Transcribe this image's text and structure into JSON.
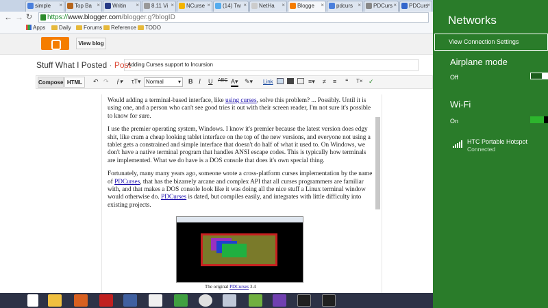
{
  "browser": {
    "tabs": [
      {
        "label": "simple",
        "color": "#4a7fdc"
      },
      {
        "label": "Top Ba",
        "color": "#b5651d"
      },
      {
        "label": "Writin",
        "color": "#263a86"
      },
      {
        "label": "8.11 Vi",
        "color": "#999999"
      },
      {
        "label": "NCurse",
        "color": "#f4b400"
      },
      {
        "label": "(14) Tw",
        "color": "#55acee"
      },
      {
        "label": "NetHa",
        "color": "#cccccc"
      },
      {
        "label": "Blogge",
        "color": "#f57d00"
      },
      {
        "label": "pdcurs",
        "color": "#4a7fdc"
      },
      {
        "label": "PDCurs",
        "color": "#888888"
      },
      {
        "label": "PDCurs",
        "color": "#3366cc"
      }
    ],
    "url_scheme": "https://",
    "url_host": "www.blogger.com",
    "url_rest": "/blogger.g?blogID",
    "bookmarks": [
      "Apps",
      "Daily",
      "Forums",
      "Reference",
      "TODO"
    ]
  },
  "blogger": {
    "view_blog": "View blog",
    "blog_name": "Stuff What I Posted",
    "separator": " · ",
    "post_crumb": "Post",
    "post_title": "Adding Curses support to Incursion",
    "modes": [
      "Compose",
      "HTML"
    ],
    "format_select": "Normal",
    "link_label": "Link",
    "paragraphs": [
      [
        {
          "t": "Would adding a terminal-based interface, like "
        },
        {
          "t": "using curses",
          "link": true
        },
        {
          "t": ", solve this problem? ... Possibly. Until it is using one, and a person who can't see good tries it out with their screen reader, I'm not sure it's possible to know for sure."
        }
      ],
      [
        {
          "t": "I use the premier operating system, Windows. I know it's premier because the latest version does edgy shit, like cram a cheap looking tablet interface on the top of the new versions, and everyone not using a tablet gets a constrained and simple interface that doesn't do half of what it used to. On Windows, we don't have a native terminal program that handles ANSI escape codes. This is typically how terminals are implemented. What we do have is a DOS console that does it's own special thing."
        }
      ],
      [
        {
          "t": "Fortunately, many many years ago, someone wrote a cross-platform curses implementation by the name of "
        },
        {
          "t": "PDCurses",
          "link": true
        },
        {
          "t": ", that has the bizarrely arcane and complex API that all curses programmers are familiar with, and that makes a DOS console look like it was doing all the nice stuff a Linux terminal window would otherwise do. "
        },
        {
          "t": "PDCurses",
          "link": true
        },
        {
          "t": " is dated, but compiles easily, and integrates with little difficulty into existing projects."
        }
      ]
    ],
    "caption_pre": "The original ",
    "caption_link": "PDCurses",
    "caption_post": " 3.4"
  },
  "networks": {
    "title": "Networks",
    "view_connection_settings": "View Connection Settings",
    "airplane_mode_label": "Airplane mode",
    "airplane_mode_state": "Off",
    "wifi_label": "Wi-Fi",
    "wifi_state": "On",
    "network_name": "HTC Portable Hotspot",
    "network_status": "Connected"
  },
  "taskbar": {
    "icons": [
      "windows-start-icon",
      "file-explorer-icon",
      "paint-brush-icon",
      "red-app-icon",
      "pen-tablet-icon",
      "character-map-icon",
      "spreadsheet-icon",
      "chrome-icon",
      "window-app-icon",
      "zip-app-icon",
      "visual-studio-icon",
      "console-icon",
      "console-icon-2"
    ]
  }
}
